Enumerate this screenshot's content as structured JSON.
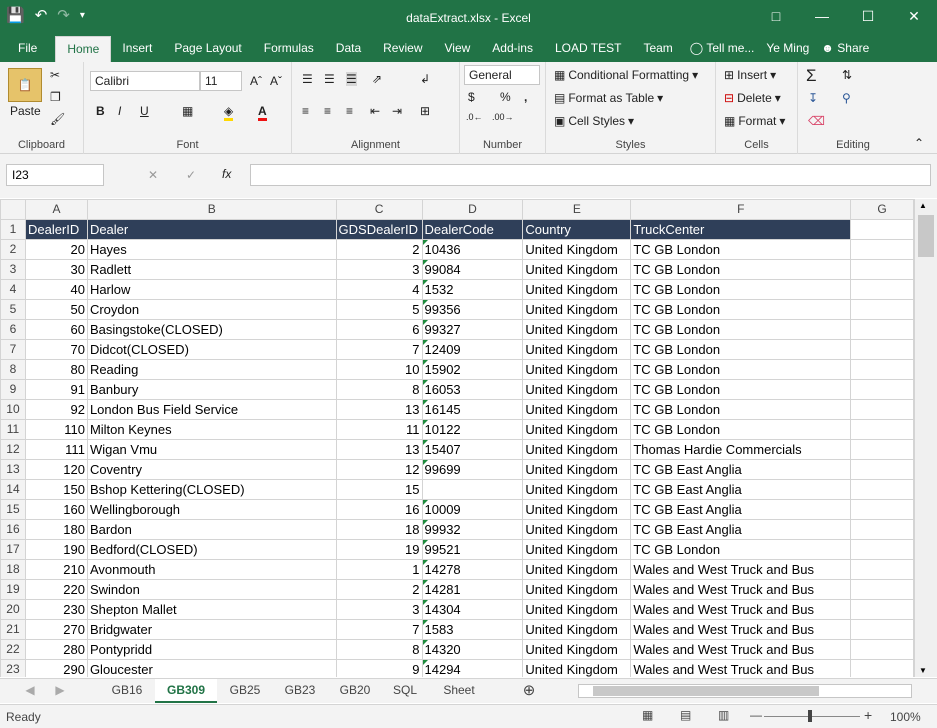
{
  "window": {
    "title": "dataExtract.xlsx - Excel",
    "user": "Ye Ming",
    "share": "Share",
    "tell_me": "Tell me..."
  },
  "ribbon_tabs": [
    "File",
    "Home",
    "Insert",
    "Page Layout",
    "Formulas",
    "Data",
    "Review",
    "View",
    "Add-ins",
    "LOAD TEST",
    "Team"
  ],
  "ribbon": {
    "clipboard": {
      "label": "Clipboard",
      "paste": "Paste"
    },
    "font": {
      "label": "Font",
      "name": "Calibri",
      "size": "11"
    },
    "alignment": {
      "label": "Alignment"
    },
    "number": {
      "label": "Number",
      "format": "General"
    },
    "styles": {
      "label": "Styles",
      "conditional": "Conditional Formatting",
      "format_table": "Format as Table",
      "cell_styles": "Cell Styles"
    },
    "cells": {
      "label": "Cells",
      "insert": "Insert",
      "delete": "Delete",
      "format": "Format"
    },
    "editing": {
      "label": "Editing"
    }
  },
  "formula_bar": {
    "name_box": "I23",
    "formula": ""
  },
  "columns": [
    "A",
    "B",
    "C",
    "D",
    "E",
    "F",
    "G"
  ],
  "header_row": [
    "DealerID",
    "Dealer",
    "GDSDealerID",
    "DealerCode",
    "Country",
    "TruckCenter"
  ],
  "rows": [
    [
      "20",
      "Hayes",
      "2",
      "10436",
      "United Kingdom",
      "TC GB London"
    ],
    [
      "30",
      "Radlett",
      "3",
      "99084",
      "United Kingdom",
      "TC GB London"
    ],
    [
      "40",
      "Harlow",
      "4",
      "1532",
      "United Kingdom",
      "TC GB London"
    ],
    [
      "50",
      "Croydon",
      "5",
      "99356",
      "United Kingdom",
      "TC GB London"
    ],
    [
      "60",
      "Basingstoke(CLOSED)",
      "6",
      "99327",
      "United Kingdom",
      "TC GB London"
    ],
    [
      "70",
      "Didcot(CLOSED)",
      "7",
      "12409",
      "United Kingdom",
      "TC GB London"
    ],
    [
      "80",
      "Reading",
      "10",
      "15902",
      "United Kingdom",
      "TC GB London"
    ],
    [
      "91",
      "Banbury",
      "8",
      "16053",
      "United Kingdom",
      "TC GB London"
    ],
    [
      "92",
      "London Bus Field Service",
      "13",
      "16145",
      "United Kingdom",
      "TC GB London"
    ],
    [
      "110",
      "Milton Keynes",
      "11",
      "10122",
      "United Kingdom",
      "TC GB London"
    ],
    [
      "111",
      "Wigan Vmu",
      "13",
      "15407",
      "United Kingdom",
      "Thomas Hardie Commercials"
    ],
    [
      "120",
      "Coventry",
      "12",
      "99699",
      "United Kingdom",
      "TC GB East Anglia"
    ],
    [
      "150",
      "Bshop Kettering(CLOSED)",
      "15",
      "",
      "United Kingdom",
      "TC GB East Anglia"
    ],
    [
      "160",
      "Wellingborough",
      "16",
      "10009",
      "United Kingdom",
      "TC GB East Anglia"
    ],
    [
      "180",
      "Bardon",
      "18",
      "99932",
      "United Kingdom",
      "TC GB East Anglia"
    ],
    [
      "190",
      "Bedford(CLOSED)",
      "19",
      "99521",
      "United Kingdom",
      "TC GB London"
    ],
    [
      "210",
      "Avonmouth",
      "1",
      "14278",
      "United Kingdom",
      "Wales and West Truck and Bus"
    ],
    [
      "220",
      "Swindon",
      "2",
      "14281",
      "United Kingdom",
      "Wales and West Truck and Bus"
    ],
    [
      "230",
      "Shepton Mallet",
      "3",
      "14304",
      "United Kingdom",
      "Wales and West Truck and Bus"
    ],
    [
      "270",
      "Bridgwater",
      "7",
      "1583",
      "United Kingdom",
      "Wales and West Truck and Bus"
    ],
    [
      "280",
      "Pontypridd",
      "8",
      "14320",
      "United Kingdom",
      "Wales and West Truck and Bus"
    ],
    [
      "290",
      "Gloucester",
      "9",
      "14294",
      "United Kingdom",
      "Wales and West Truck and Bus"
    ]
  ],
  "sheet_tabs": [
    "GB16",
    "GB309",
    "GB25",
    "GB23",
    "GB20",
    "SQL",
    "Sheet"
  ],
  "active_sheet": "GB309",
  "status": {
    "text": "Ready",
    "zoom": "100%"
  }
}
